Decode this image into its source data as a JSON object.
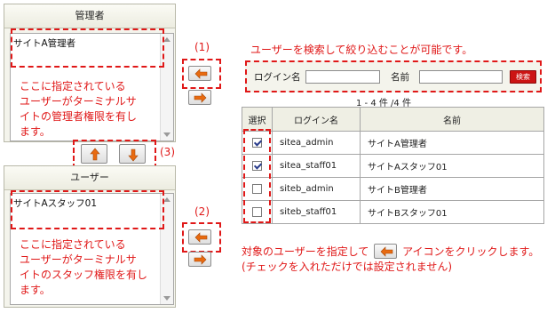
{
  "admin_panel": {
    "title": "管理者",
    "selected_item": "サイトA管理者",
    "description_lines": [
      "ここに指定されている",
      "ユーザーがターミナルサ",
      "イトの管理者権限を有し",
      "ます。"
    ]
  },
  "user_panel": {
    "title": "ユーザー",
    "selected_item": "サイトAスタッフ01",
    "description_lines": [
      "ここに指定されている",
      "ユーザーがターミナルサ",
      "イトのスタッフ権限を有し",
      "ます。"
    ]
  },
  "callouts": {
    "c1": "(1)",
    "c2": "(2)",
    "c3": "(3)"
  },
  "search": {
    "hint": "ユーザーを検索して絞り込むことが可能です。",
    "login_label": "ログイン名",
    "login_value": "",
    "name_label": "名前",
    "name_value": "",
    "button_label": "検索"
  },
  "result_count": "1 - 4 件 /4 件",
  "table": {
    "headers": [
      "選択",
      "ログイン名",
      "名前"
    ],
    "rows": [
      {
        "checked": true,
        "login": "sitea_admin",
        "name": "サイトA管理者"
      },
      {
        "checked": true,
        "login": "sitea_staff01",
        "name": "サイトAスタッフ01"
      },
      {
        "checked": false,
        "login": "siteb_admin",
        "name": "サイトB管理者"
      },
      {
        "checked": false,
        "login": "siteb_staff01",
        "name": "サイトBスタッフ01"
      }
    ]
  },
  "note": {
    "before_icon": "対象のユーザーを指定して",
    "after_icon": "アイコンをクリックします。",
    "line2": "(チェックを入れただけでは設定されません)"
  },
  "icons": {
    "move_left": "arrow-left-icon",
    "move_right": "arrow-right-icon",
    "move_up": "arrow-up-icon",
    "move_down": "arrow-down-icon"
  },
  "colors": {
    "annotation": "#e01818",
    "arrow_orange": "#e86a10",
    "search_button": "#cc1414"
  }
}
